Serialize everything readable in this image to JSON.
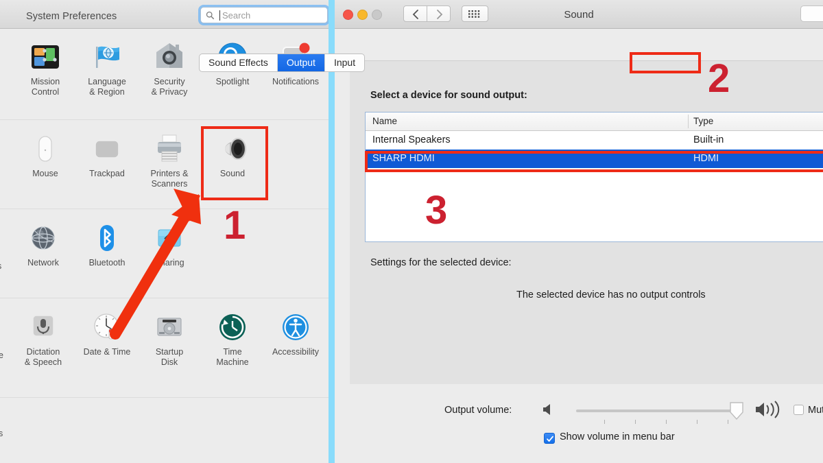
{
  "system_preferences": {
    "window_title": "System Preferences",
    "search": {
      "placeholder": "Search",
      "value": "",
      "icon": "search-icon"
    },
    "rows": [
      {
        "items": [
          {
            "label": "Mission\nControl",
            "icon": "mission-control-icon"
          },
          {
            "label": "Language\n& Region",
            "icon": "language-region-flag-icon"
          },
          {
            "label": "Security\n& Privacy",
            "icon": "security-privacy-house-icon"
          },
          {
            "label": "Spotlight",
            "icon": "spotlight-magnifier-icon"
          },
          {
            "label": "Notifications",
            "icon": "notifications-icon"
          }
        ]
      },
      {
        "items": [
          {
            "label": "Mouse",
            "icon": "mouse-icon"
          },
          {
            "label": "Trackpad",
            "icon": "trackpad-icon"
          },
          {
            "label": "Printers &\nScanners",
            "icon": "printer-icon"
          },
          {
            "label": "Sound",
            "icon": "sound-speaker-icon",
            "highlighted": true
          }
        ]
      },
      {
        "partial_left_label": "s",
        "items": [
          {
            "label": "Network",
            "icon": "network-globe-icon"
          },
          {
            "label": "Bluetooth",
            "icon": "bluetooth-icon"
          },
          {
            "label": "Sharing",
            "icon": "sharing-folder-icon"
          }
        ]
      },
      {
        "partial_left_label": "e",
        "items": [
          {
            "label": "Dictation\n& Speech",
            "icon": "dictation-microphone-icon"
          },
          {
            "label": "Date & Time",
            "icon": "date-time-clock-icon"
          },
          {
            "label": "Startup\nDisk",
            "icon": "startup-disk-icon"
          },
          {
            "label": "Time\nMachine",
            "icon": "time-machine-icon"
          },
          {
            "label": "Accessibility",
            "icon": "accessibility-icon"
          }
        ]
      }
    ],
    "bottom_partial_label": "s"
  },
  "sound_window": {
    "title": "Sound",
    "traffic_lights": [
      "close-button",
      "minimize-button",
      "maximize-button"
    ],
    "nav": {
      "back": "back-chevron-icon",
      "forward": "forward-chevron-icon",
      "grid": "show-all-grid-icon"
    },
    "search": {
      "placeholder": "",
      "value": ""
    },
    "tabs": [
      {
        "label": "Sound Effects",
        "selected": false
      },
      {
        "label": "Output",
        "selected": true
      },
      {
        "label": "Input",
        "selected": false
      }
    ],
    "select_device_label": "Select a device for sound output:",
    "table": {
      "columns": [
        "Name",
        "Type"
      ],
      "rows": [
        {
          "name": "Internal Speakers",
          "type": "Built-in",
          "selected": false
        },
        {
          "name": "SHARP HDMI",
          "type": "HDMI",
          "selected": true
        }
      ]
    },
    "settings_label": "Settings for the selected device:",
    "no_controls_message": "The selected device has no output controls",
    "output_volume_label": "Output volume:",
    "volume_percent": 97,
    "mute_label": "Mute",
    "mute_checked": false,
    "show_volume_label": "Show volume in menu bar",
    "show_volume_checked": true
  },
  "annotations": {
    "markers": [
      {
        "text": "1",
        "target": "sound-preference-icon"
      },
      {
        "text": "2",
        "target": "output-tab"
      },
      {
        "text": "3",
        "target": "device-list"
      }
    ],
    "arrow": "red-arrow-pointing-to-sound-icon"
  },
  "colors": {
    "annotation_red": "#ee2b17",
    "marker_red": "#cc2130",
    "selection_blue": "#0f5ad5",
    "tab_blue": "#1367e4",
    "divider_cyan": "#89dcfb",
    "window_gray": "#ececec",
    "card_gray": "#e2e2e2"
  }
}
